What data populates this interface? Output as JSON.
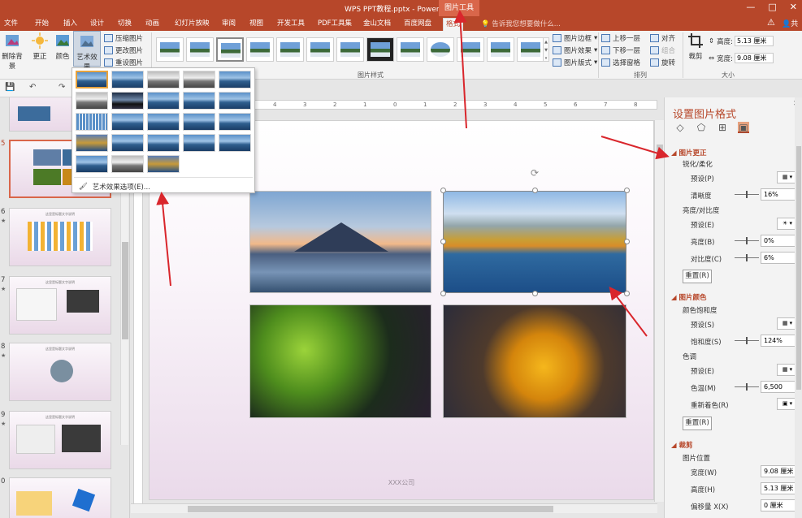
{
  "titlebar": {
    "title": "WPS PPT教程.pptx - PowerPoint",
    "context_tab": "图片工具",
    "min": "—",
    "max": "□",
    "close": "✕"
  },
  "tabs": [
    "文件",
    "开始",
    "插入",
    "设计",
    "切换",
    "动画",
    "幻灯片放映",
    "审阅",
    "视图",
    "开发工具",
    "PDF工具集",
    "金山文档",
    "百度网盘",
    "格式"
  ],
  "tellme": "告诉我您想要做什么...",
  "share": "共",
  "ribbon": {
    "remove_bg": "删除背景",
    "corrections": "更正",
    "color": "颜色",
    "art_effects": "艺术效果",
    "compress": "压缩图片",
    "change": "更改图片",
    "reset": "重设图片",
    "adjust_group": "调",
    "styles_group": "图片样式",
    "border": "图片边框",
    "effects": "图片效果",
    "layout": "图片版式",
    "bring_forward": "上移一层",
    "send_backward": "下移一层",
    "selection_pane": "选择窗格",
    "align": "对齐",
    "group": "组合",
    "rotate": "旋转",
    "arrange_group": "排列",
    "crop": "裁剪",
    "height_label": "高度:",
    "height_value": "5.13 厘米",
    "width_label": "宽度:",
    "width_value": "9.08 厘米",
    "size_group": "大小"
  },
  "art_popup": {
    "options_label": "艺术效果选项(E)..."
  },
  "thumbnails": [
    {
      "num": "",
      "title": ""
    },
    {
      "num": "5",
      "title": ""
    },
    {
      "num": "6",
      "title": "这里是标题文字说明"
    },
    {
      "num": "7",
      "title": "这里是标题文字说明"
    },
    {
      "num": "8",
      "title": "这里是标题文字说明"
    },
    {
      "num": "9",
      "title": "这里是标题文字说明"
    },
    {
      "num": "0",
      "title": ""
    }
  ],
  "slide": {
    "footer": "XXX公司"
  },
  "format_pane": {
    "title": "设置图片格式",
    "close": "✕",
    "sec_correction": "图片更正",
    "sharpen": "锐化/柔化",
    "preset1": "预设(P)",
    "clarity": "清晰度",
    "clarity_val": "16%",
    "bright_contrast": "亮度/对比度",
    "preset2": "预设(E)",
    "brightness": "亮度(B)",
    "brightness_val": "0%",
    "contrast": "对比度(C)",
    "contrast_val": "6%",
    "reset1": "重置(R)",
    "sec_color": "图片颜色",
    "saturation_title": "颜色饱和度",
    "preset3": "预设(S)",
    "saturation": "饱和度(S)",
    "saturation_val": "124%",
    "tone_title": "色调",
    "preset4": "预设(E)",
    "temperature": "色温(M)",
    "temperature_val": "6,500",
    "recolor": "重新着色(R)",
    "reset2": "重置(R)",
    "sec_crop": "裁剪",
    "pic_position": "图片位置",
    "width": "宽度(W)",
    "width_val": "9.08 厘米",
    "height": "高度(H)",
    "height_val": "5.13 厘米",
    "offset": "偏移量 X(X)",
    "offset_val": "0 厘米"
  }
}
